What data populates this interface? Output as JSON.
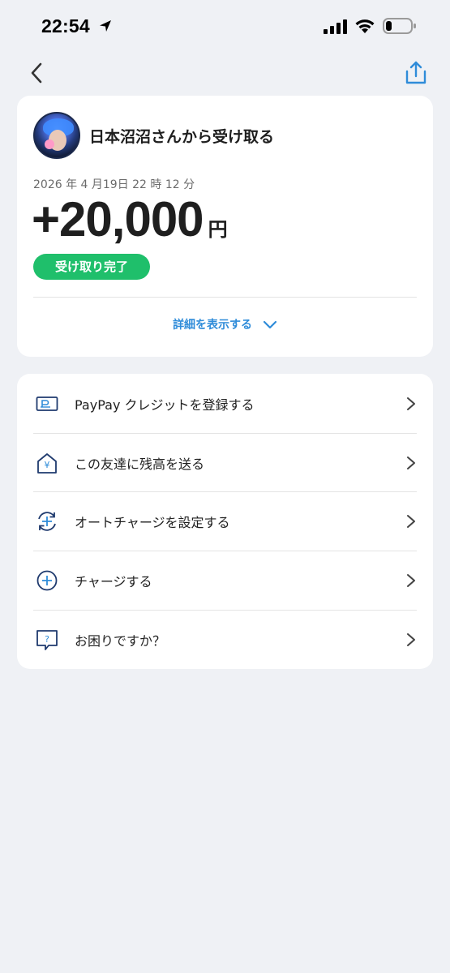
{
  "status_bar": {
    "time": "22:54"
  },
  "receipt": {
    "title": "日本沼沼さんから受け取る",
    "date": "2026 年 4 月19日 22 時 12 分",
    "amount": "+20,000",
    "unit": "円",
    "status": "受け取り完了",
    "details_toggle": "詳細を表示する"
  },
  "menu": {
    "items": [
      {
        "label": "PayPay クレジットを登録する",
        "icon": "credit-card-icon"
      },
      {
        "label": "この友達に残高を送る",
        "icon": "send-yen-house-icon"
      },
      {
        "label": "オートチャージを設定する",
        "icon": "auto-charge-icon"
      },
      {
        "label": "チャージする",
        "icon": "plus-circle-icon"
      },
      {
        "label": "お困りですか？",
        "icon": "help-question-icon"
      }
    ]
  },
  "colors": {
    "accent": "#2f8cd9",
    "status_green": "#1fbf6b",
    "icon_navy": "#1f3a6e",
    "background": "#eff1f5"
  }
}
